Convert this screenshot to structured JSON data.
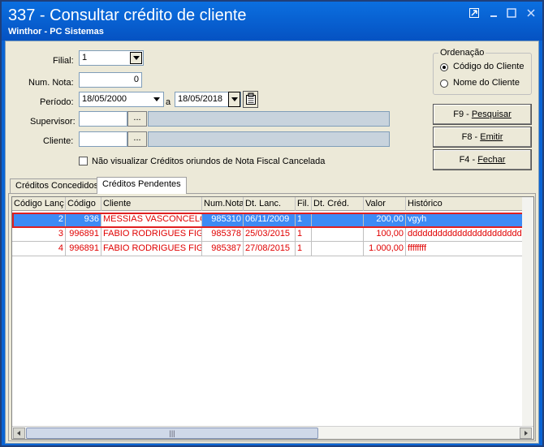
{
  "window": {
    "title": "337 - Consultar crédito de cliente",
    "subtitle": "Winthor - PC Sistemas"
  },
  "form": {
    "filial_label": "Filial:",
    "filial_value": "1",
    "num_nota_label": "Num. Nota:",
    "num_nota_value": "0",
    "periodo_label": "Período:",
    "periodo_start": "18/05/2000",
    "periodo_sep": "a",
    "periodo_end": "18/05/2018",
    "supervisor_label": "Supervisor:",
    "cliente_label": "Cliente:",
    "ellipsis": "...",
    "checkbox_label": "Não visualizar Créditos oriundos de Nota Fiscal Cancelada"
  },
  "ordenacao": {
    "title": "Ordenação",
    "option1": "Código do Cliente",
    "option2": "Nome do Cliente"
  },
  "buttons": {
    "pesquisar_key": "F9 - ",
    "pesquisar_label": "Pesquisar",
    "emitir_key": "F8 - ",
    "emitir_label": "Emitir",
    "fechar_key": "F4 - ",
    "fechar_label": "Fechar"
  },
  "tabs": {
    "concedidos": "Créditos Concedidos",
    "pendentes": "Créditos Pendentes"
  },
  "grid": {
    "columns": [
      "Código Lanç",
      "Código",
      "Cliente",
      "Num.Nota",
      "Dt. Lanc.",
      "Fil.",
      "Dt. Créd.",
      "Valor",
      "Histórico"
    ],
    "rows": [
      {
        "lanc": "2",
        "codigo": "936",
        "cliente": "MESSIAS VASCONCELOS",
        "nota": "985310",
        "dt_lanc": "06/11/2009",
        "fil": "1",
        "dt_cred": "",
        "valor": "200,00",
        "historico": "vgyh"
      },
      {
        "lanc": "3",
        "codigo": "996891",
        "cliente": "FABIO RODRIGUES FIGU",
        "nota": "985378",
        "dt_lanc": "25/03/2015",
        "fil": "1",
        "dt_cred": "",
        "valor": "100,00",
        "historico": "dddddddddddddddddddddddddd"
      },
      {
        "lanc": "4",
        "codigo": "996891",
        "cliente": "FABIO RODRIGUES FIGU",
        "nota": "985387",
        "dt_lanc": "27/08/2015",
        "fil": "1",
        "dt_cred": "",
        "valor": "1.000,00",
        "historico": "ffffffff"
      }
    ]
  },
  "colors": {
    "titlebar": "#0b6fe0",
    "selection": "#3d8bf5",
    "row_text": "#e00000",
    "highlight_border": "#e02020"
  }
}
